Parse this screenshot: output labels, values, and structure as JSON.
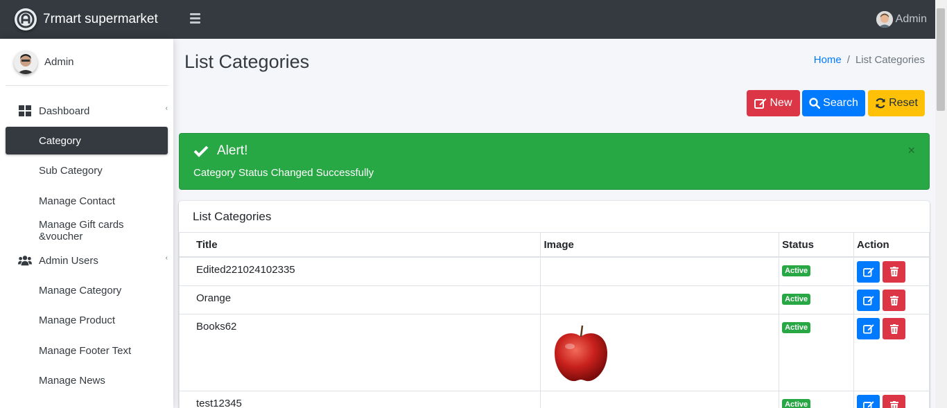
{
  "brand": {
    "name": "7rmart supermarket",
    "logo_icon": "brand-logo-icon"
  },
  "topbar": {
    "menu_icon": "hamburger-icon",
    "user_name": "Admin"
  },
  "sidebar": {
    "user_name": "Admin",
    "items": [
      {
        "label": "Dashboard",
        "icon": "dashboard-icon",
        "has_caret": true
      },
      {
        "label": "Category",
        "active": true
      },
      {
        "label": "Sub Category"
      },
      {
        "label": "Manage Contact"
      },
      {
        "label": "Manage Gift cards &voucher"
      },
      {
        "label": "Admin Users",
        "icon": "users-icon",
        "has_caret": true
      },
      {
        "label": "Manage Category"
      },
      {
        "label": "Manage Product"
      },
      {
        "label": "Manage Footer Text"
      },
      {
        "label": "Manage News"
      }
    ]
  },
  "page": {
    "title": "List Categories"
  },
  "breadcrumb": {
    "home": "Home",
    "current": "List Categories"
  },
  "buttons": {
    "new": "New",
    "search": "Search",
    "reset": "Reset"
  },
  "alert": {
    "title": "Alert!",
    "message": "Category Status Changed Successfully",
    "close": "×"
  },
  "card": {
    "title": "List Categories",
    "columns": [
      "Title",
      "Image",
      "Status",
      "Action"
    ],
    "rows": [
      {
        "title": "Edited221024102335",
        "image": "",
        "status": "Active"
      },
      {
        "title": "Orange",
        "image": "",
        "status": "Active"
      },
      {
        "title": "Books62",
        "image": "apple",
        "status": "Active"
      },
      {
        "title": "test12345",
        "image": "",
        "status": "Active"
      }
    ]
  },
  "colors": {
    "dark": "#343a40",
    "danger": "#dc3545",
    "primary": "#007bff",
    "warning": "#ffc107",
    "success": "#28a745"
  }
}
